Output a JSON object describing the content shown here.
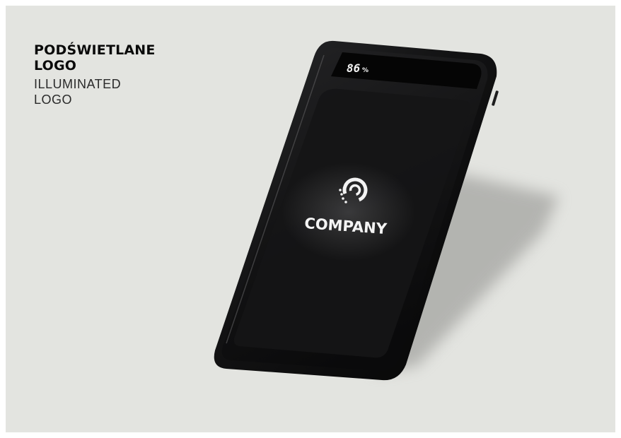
{
  "caption": {
    "polish": "PODŚWIETLANE\nLOGO",
    "english": "ILLUMINATED\nLOGO"
  },
  "device": {
    "battery_display": "86",
    "battery_unit": "%",
    "logo_text": "COMPANY",
    "logo_icon": "company-c-logo-icon"
  },
  "colors": {
    "background": "#e3e4e0",
    "device_body": "#0d0d0e",
    "logo_glow": "#f4f4f4"
  }
}
